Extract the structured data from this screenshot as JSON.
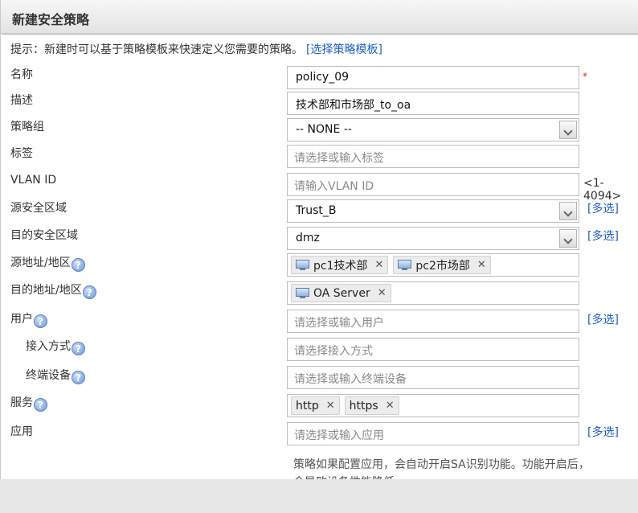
{
  "dialog": {
    "title": "新建安全策略"
  },
  "tip": {
    "text": "提示：新建时可以基于策略模板来快速定义您需要的策略。",
    "link": "[选择策略模板]"
  },
  "fields": {
    "name": {
      "label": "名称",
      "value": "policy_09",
      "required_mark": "*"
    },
    "description": {
      "label": "描述",
      "value": "技术部和市场部_to_oa"
    },
    "policy_group": {
      "label": "策略组",
      "value": "-- NONE --"
    },
    "tag": {
      "label": "标签",
      "placeholder": "请选择或输入标签"
    },
    "vlan_id": {
      "label": "VLAN ID",
      "placeholder": "请输入VLAN ID",
      "range": "<1-4094>"
    },
    "source_zone": {
      "label": "源安全区域",
      "value": "Trust_B",
      "multi": "[多选]"
    },
    "dest_zone": {
      "label": "目的安全区域",
      "value": "dmz",
      "multi": "[多选]"
    },
    "source_address": {
      "label": "源地址/地区",
      "tags": [
        "pc1技术部",
        "pc2市场部"
      ]
    },
    "dest_address": {
      "label": "目的地址/地区",
      "tags": [
        "OA Server"
      ]
    },
    "user": {
      "label": "用户",
      "placeholder": "请选择或输入用户",
      "multi": "[多选]"
    },
    "access_method": {
      "label": "接入方式",
      "placeholder": "请选择接入方式"
    },
    "terminal_device": {
      "label": "终端设备",
      "placeholder": "请选择或输入终端设备"
    },
    "service": {
      "label": "服务",
      "tags": [
        "http",
        "https"
      ]
    },
    "application": {
      "label": "应用",
      "placeholder": "请选择或输入应用",
      "multi": "[多选]",
      "note": "策略如果配置应用，会自动开启SA识别功能。功能开启后，会导致设备性能降低"
    }
  },
  "icons": {
    "help": "help-icon",
    "computer": "computer-icon",
    "remove": "remove-icon",
    "dropdown": "chevron-down-icon"
  }
}
